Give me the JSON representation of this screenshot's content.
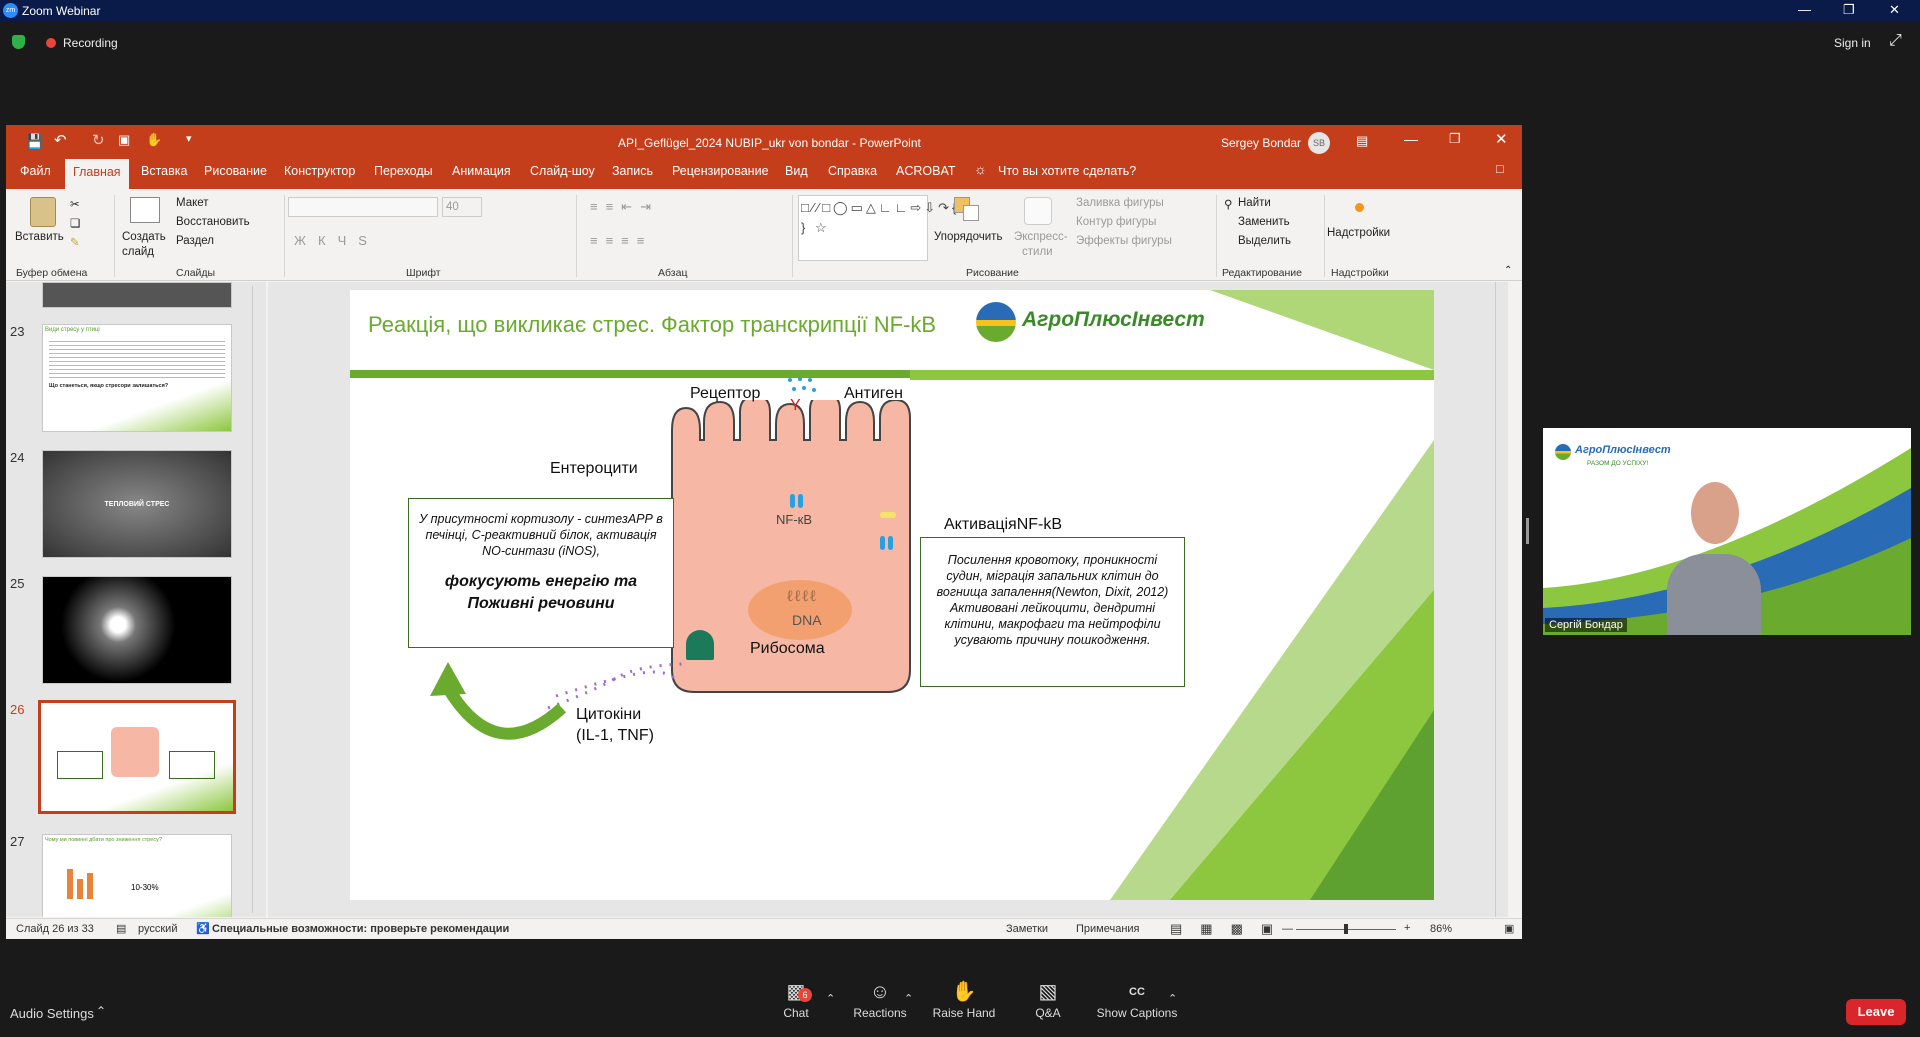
{
  "zoom": {
    "window_title": "Zoom Webinar",
    "logo": "zm",
    "recording_label": "Recording",
    "sign_in": "Sign in",
    "audio_settings": "Audio Settings",
    "chat_badge": "6",
    "bottom_buttons": [
      "Chat",
      "Reactions",
      "Raise Hand",
      "Q&A",
      "Show Captions"
    ],
    "leave_label": "Leave",
    "participant_name": "Сергій Бондар"
  },
  "powerpoint": {
    "title": "API_Geflügel_2024 NUBIP_ukr von bondar  -  PowerPoint",
    "user_name": "Sergey Bondar",
    "user_initials": "SB",
    "tabs": [
      "Файл",
      "Главная",
      "Вставка",
      "Рисование",
      "Конструктор",
      "Переходы",
      "Анимация",
      "Слайд-шоу",
      "Запись",
      "Рецензирование",
      "Вид",
      "Справка",
      "ACROBAT"
    ],
    "tell_me": "Что вы хотите сделать?",
    "ribbon": {
      "paste": "Вставить",
      "clipboard_group": "Буфер обмена",
      "new_slide_1": "Создать",
      "new_slide_2": "слайд",
      "layout": "Макет",
      "restore": "Восстановить",
      "section": "Раздел",
      "slides_group": "Слайды",
      "font_size": "40",
      "font_group": "Шрифт",
      "paragraph_group": "Абзац",
      "arrange": "Упорядочить",
      "quick_styles_1": "Экспресс-",
      "quick_styles_2": "стили",
      "shape_fill": "Заливка фигуры",
      "shape_outline": "Контур фигуры",
      "shape_effects": "Эффекты фигуры",
      "drawing_group": "Рисование",
      "find": "Найти",
      "replace": "Заменить",
      "select": "Выделить",
      "editing_group": "Редактирование",
      "addins": "Надстройки",
      "addins_group": "Надстройки"
    },
    "thumbnails": [
      {
        "num": "23",
        "title": "Види стресу у птиці",
        "question": "Що станеться, якщо стресори залишаться?"
      },
      {
        "num": "24",
        "label": "ТЕПЛОВИЙ СТРЕС"
      },
      {
        "num": "25"
      },
      {
        "num": "26"
      },
      {
        "num": "27",
        "title": "Чому ми повинні дбати про зниження стресу?",
        "label": "10-30%"
      }
    ],
    "status": {
      "slide_info": "Слайд 26 из 33",
      "language": "русский",
      "accessibility": "Специальные возможности: проверьте рекомендации",
      "notes": "Заметки",
      "comments": "Примечания",
      "zoom": "86%"
    }
  },
  "slide": {
    "title": "Реакція, що викликає стрес. Фактор транскрипції NF-kB",
    "brand": "АгроПлюсІнвест",
    "receptor": "Рецептор",
    "antigen": "Антиген",
    "enterocytes": "Ентероцити",
    "activation": "АктиваціяNF-kB",
    "nfkb": "NF-кВ",
    "dna": "DNA",
    "ribosome": "Рибосома",
    "cytokines_1": "Цитокіни",
    "cytokines_2": "(IL-1, TNF)",
    "left_box_text": "У присутності кортизолу - синтезАРР в печінці, С-реактивний білок, активація NO-синтази (iNOS),",
    "left_box_bold_1": "фокусують енергію та",
    "left_box_bold_2": "Поживні речовини",
    "right_box_text": "Посилення кровотоку, проникності судин, міграція запальних клітин до вогнища запалення(Newton, Dixit, 2012) Активовані лейкоцити, дендритні клітини, макрофаги та нейтрофіли усувають причину пошкодження."
  },
  "video": {
    "brand": "АгроПлюсІнвест",
    "tagline": "РАЗОМ ДО УСПІХУ!"
  },
  "colors": {
    "zoom_title_bg": "#0a1b4a",
    "ppt_accent": "#c43e1c",
    "slide_green": "#8dc63f",
    "slide_title": "#6aaa2e",
    "cell_fill": "#f6b8a4",
    "leave_red": "#d9262b"
  }
}
